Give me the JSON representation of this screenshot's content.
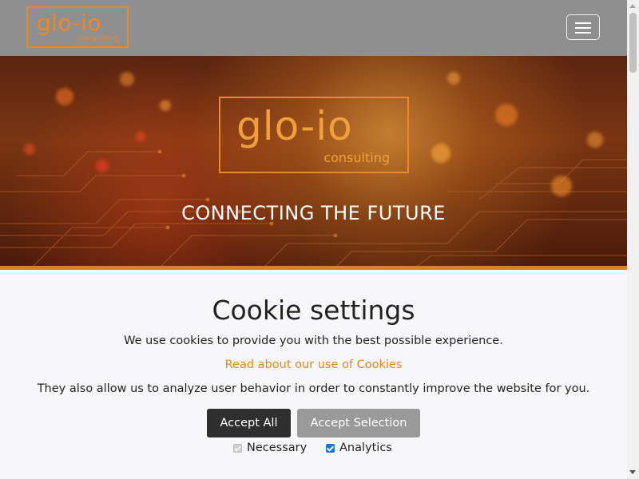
{
  "navbar": {
    "logo_main": "glo-io",
    "logo_sub": "consulting",
    "toggler_icon": "hamburger-icon"
  },
  "hero": {
    "logo_main": "glo-io",
    "logo_sub": "consulting",
    "tagline": "CONNECTING THE FUTURE"
  },
  "cookie": {
    "title": "Cookie settings",
    "text1": "We use cookies to provide you with the best possible experience.",
    "link": "Read about our use of Cookies",
    "text2": "They also allow us to analyze user behavior in order to constantly improve the website for you.",
    "accept_all": "Accept All",
    "accept_selection": "Accept Selection",
    "options": [
      {
        "label": "Necessary",
        "checked": true,
        "disabled": true
      },
      {
        "label": "Analytics",
        "checked": true,
        "disabled": false
      }
    ]
  },
  "colors": {
    "accent": "#e8892a",
    "navbar": "#8f8f8f",
    "accept_all_bg": "#2f2f2f",
    "accept_selection_bg": "#9a9a9a",
    "link": "#e0861f"
  }
}
